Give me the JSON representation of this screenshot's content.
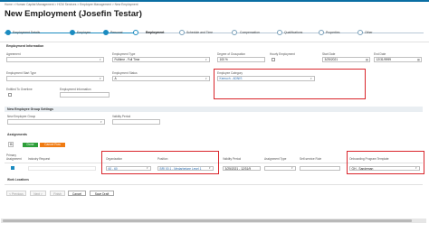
{
  "breadcrumb": "Home  >  Human Capital Management  >  HCM Services  >  Employee Management  >  New Employment",
  "page_title": "New Employment (Josefin Testar)",
  "steps": [
    {
      "label": "Employment Details",
      "state": "done"
    },
    {
      "label": "Employee",
      "state": "done"
    },
    {
      "label": "Personal",
      "state": "done"
    },
    {
      "label": "Employment",
      "state": "active"
    },
    {
      "label": "Schedule and Time",
      "state": "todo"
    },
    {
      "label": "Compensation",
      "state": "todo"
    },
    {
      "label": "Qualifications",
      "state": "todo"
    },
    {
      "label": "Properties",
      "state": "todo"
    },
    {
      "label": "Other",
      "state": "todo"
    }
  ],
  "employment_info": {
    "title": "Employment Information",
    "agreement_label": "Agreement",
    "agreement_value": "",
    "employment_type_label": "Employment Type",
    "employment_type_value": "Fulltime - Full Time",
    "degree_label": "Degree of Occupation",
    "degree_value": "100 %",
    "hourly_label": "Hourly Employment",
    "start_date_label": "Start Date",
    "start_date_value": "3/25/2021",
    "end_date_label": "End Date",
    "end_date_value": "12/31/9999",
    "start_type_label": "Employment Start Type",
    "start_type_value": "",
    "status_label": "Employment Status",
    "status_value": "A",
    "category_label": "Employee Category",
    "category_value": "Kemuch - ADNIS",
    "entitled_label": "Entitled To Overtime",
    "info_label": "Employment Information",
    "info_value": ""
  },
  "group_settings": {
    "title": "New Employee Group Settings",
    "group_label": "New Employee Group",
    "group_value": "",
    "validity_label": "Validity Period",
    "validity_value": ""
  },
  "assignments": {
    "title": "Assignments",
    "done_button": "Done",
    "cancel_button": "Cancel Row",
    "headers": [
      "Primary Assignment",
      "Industry Request",
      "Organization",
      "Position",
      "Validity Period",
      "Assignment Type",
      "Self-service Role",
      "Onboarding Program Template"
    ],
    "row": {
      "organization": "60 - 60",
      "position": "BRI 00.1 - Medarbetare Level 1",
      "validity": "3/25/2021 - 12/31/9",
      "onboarding": "GH - Sandeman"
    }
  },
  "work_locations": "Work Locations",
  "footer": {
    "previous": "< Previous",
    "next": "Next >",
    "finish": "Finish",
    "cancel": "Cancel",
    "save_draft": "Save Draft"
  },
  "colors": {
    "accent": "#1b8bc0",
    "highlight": "#d9252b",
    "done_button": "#2e9f3a",
    "cancel_button": "#f07b12"
  }
}
